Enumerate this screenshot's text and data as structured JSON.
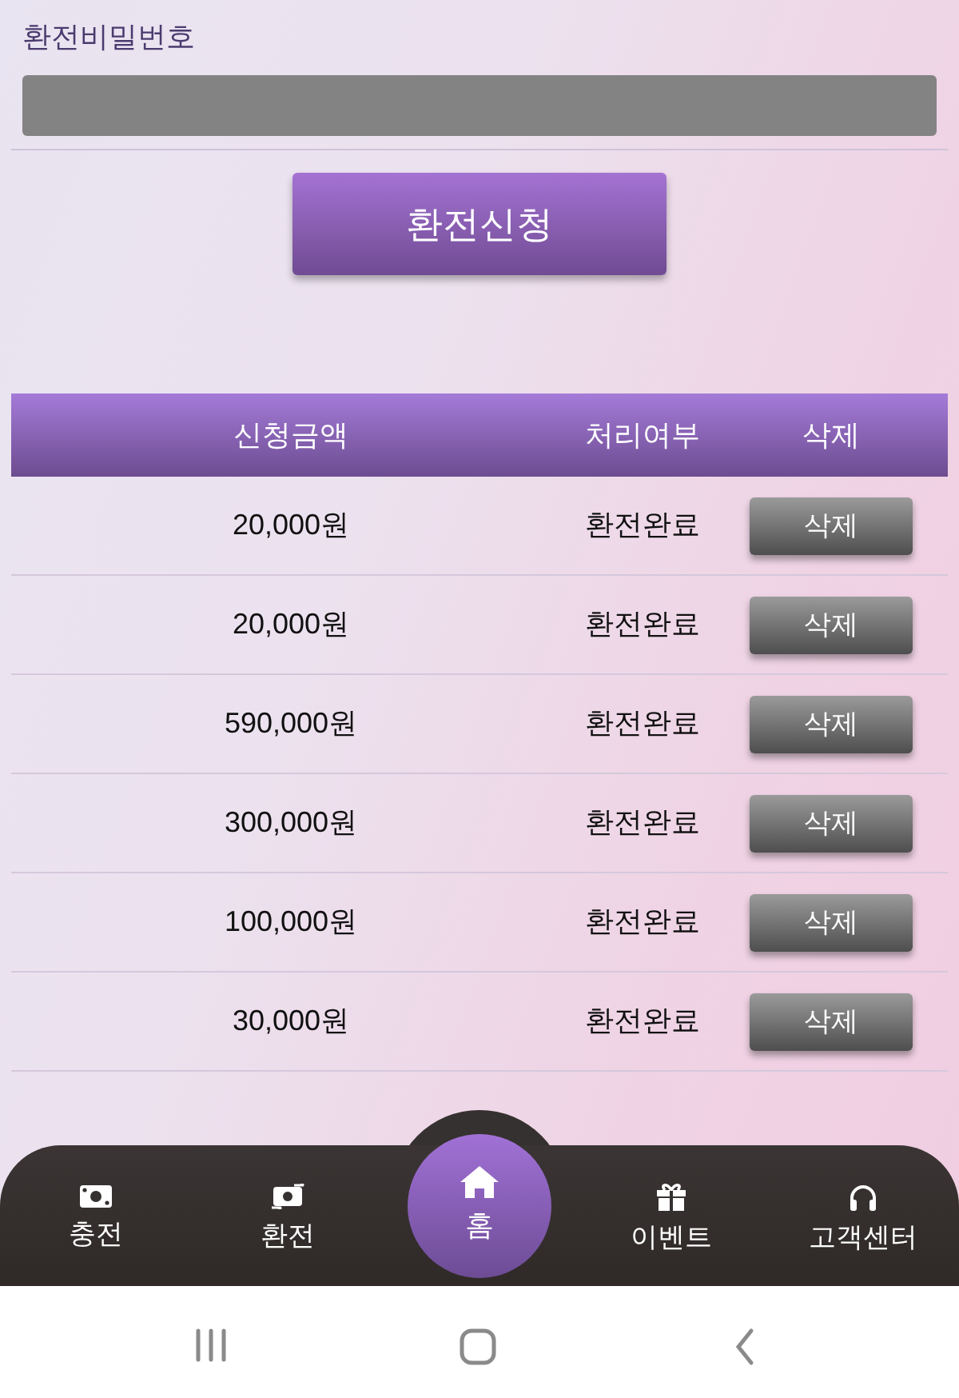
{
  "form": {
    "label": "환전비밀번호",
    "submit": "환전신청"
  },
  "table": {
    "columns": [
      "신청금액",
      "처리여부",
      "삭제"
    ],
    "rows": [
      {
        "amount": "20,000원",
        "status": "환전완료",
        "action": "삭제"
      },
      {
        "amount": "20,000원",
        "status": "환전완료",
        "action": "삭제"
      },
      {
        "amount": "590,000원",
        "status": "환전완료",
        "action": "삭제"
      },
      {
        "amount": "300,000원",
        "status": "환전완료",
        "action": "삭제"
      },
      {
        "amount": "100,000원",
        "status": "환전완료",
        "action": "삭제"
      },
      {
        "amount": "30,000원",
        "status": "환전완료",
        "action": "삭제"
      }
    ]
  },
  "bottom_nav": [
    {
      "label": "충전",
      "selected": false
    },
    {
      "label": "환전",
      "selected": false
    },
    {
      "label": "홈",
      "selected": true
    },
    {
      "label": "이벤트",
      "selected": false
    },
    {
      "label": "고객센터",
      "selected": false
    }
  ]
}
